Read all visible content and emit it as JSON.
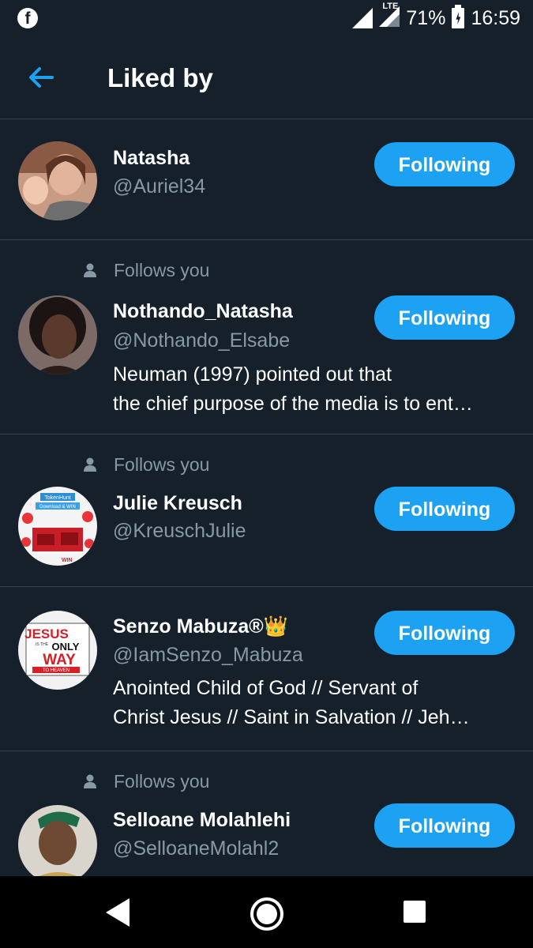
{
  "status_bar": {
    "network": "LTE",
    "battery": "71%",
    "time": "16:59"
  },
  "header": {
    "title": "Liked by"
  },
  "follows_label": "Follows you",
  "users": [
    {
      "name": "Natasha",
      "handle": "@Auriel34",
      "follows_you": false,
      "button": "Following",
      "bio": []
    },
    {
      "name": "Nothando_Natasha",
      "handle": "@Nothando_Elsabe",
      "follows_you": true,
      "button": "Following",
      "bio": [
        "Neuman (1997) pointed out that",
        "the chief purpose of the media is to ent…"
      ]
    },
    {
      "name": "Julie Kreusch",
      "handle": "@KreuschJulie",
      "follows_you": true,
      "button": "Following",
      "bio": []
    },
    {
      "name": "Senzo Mabuza®👑",
      "handle": "@IamSenzo_Mabuza",
      "follows_you": false,
      "button": "Following",
      "bio": [
        "Anointed Child of God // Servant of",
        "Christ Jesus // Saint in Salvation // Jeh…"
      ]
    },
    {
      "name": "Selloane Molahlehi",
      "handle": "@SelloaneMolahl2",
      "follows_you": true,
      "button": "Following",
      "bio": []
    }
  ],
  "avatar_labels": {
    "julie": [
      "TokenHunt",
      "Download & WIN",
      "WIN"
    ],
    "senzo": [
      "JESUS",
      "IS THE",
      "ONLY",
      "WAY",
      "TO HEAVEN"
    ]
  },
  "colors": {
    "background": "#15202b",
    "accent": "#1da1f2",
    "secondary_text": "#8899a6",
    "divider": "#38444d"
  }
}
